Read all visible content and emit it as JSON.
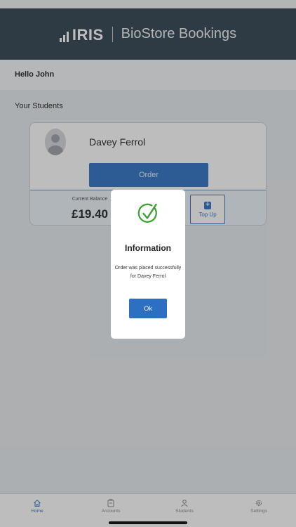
{
  "header": {
    "logo_text": "IRIS",
    "app_title": "BioStore Bookings"
  },
  "greeting": "Hello John",
  "students_section": {
    "title": "Your Students"
  },
  "student_card": {
    "name": "Davey Ferrol",
    "order_label": "Order",
    "balance_label": "Current Balance",
    "balance_value": "£19.40",
    "topup_label": "Top Up"
  },
  "modal": {
    "icon": "check-circle-icon",
    "title": "Information",
    "message": "Order was placed successfully for Davey Ferrol",
    "ok_label": "Ok"
  },
  "tabbar": {
    "tabs": [
      {
        "label": "Home",
        "icon": "home-icon",
        "active": true
      },
      {
        "label": "Accounts",
        "icon": "wallet-icon",
        "active": false
      },
      {
        "label": "Students",
        "icon": "person-icon",
        "active": false
      },
      {
        "label": "Settings",
        "icon": "gear-icon",
        "active": false
      }
    ]
  },
  "colors": {
    "header_bg": "#3f4f5c",
    "accent": "#3d7cc9",
    "success": "#3aa12e"
  }
}
